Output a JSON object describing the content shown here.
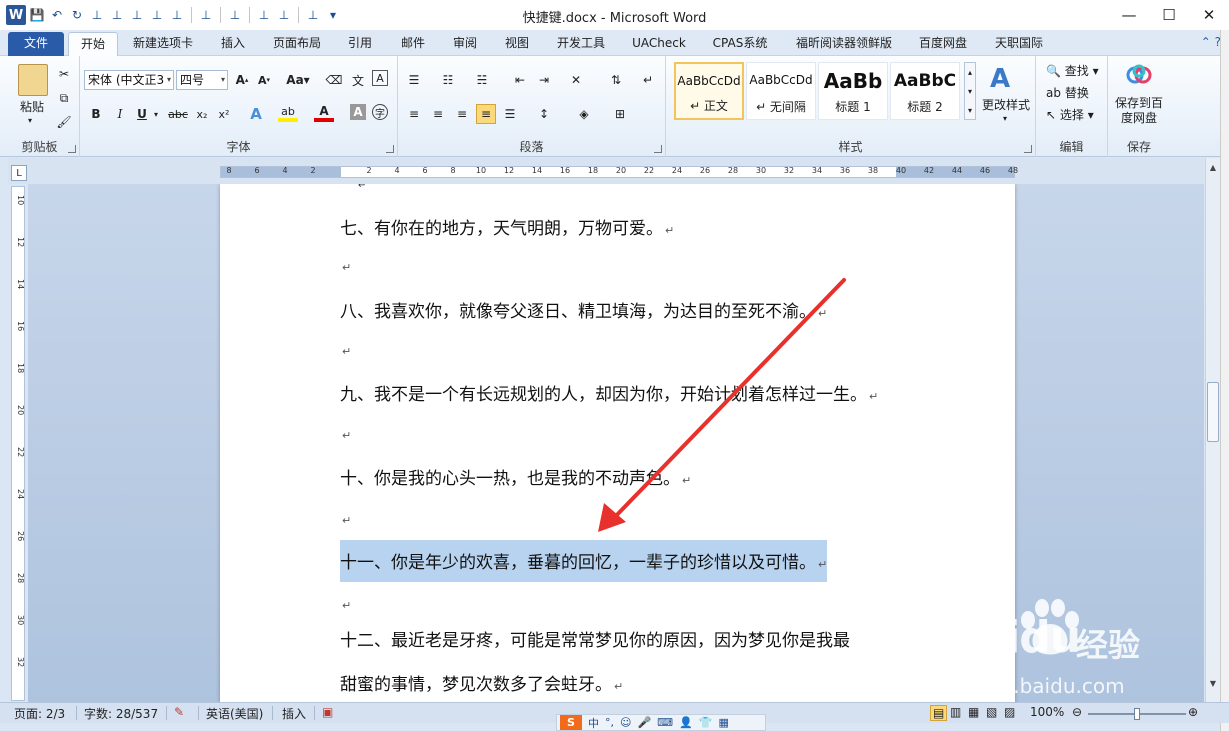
{
  "window": {
    "title": "快捷键.docx - Microsoft Word",
    "minimize": "—",
    "maximize": "☐",
    "close": "✕"
  },
  "tabs": [
    {
      "label": "文件"
    },
    {
      "label": "开始"
    },
    {
      "label": "新建选项卡"
    },
    {
      "label": "插入"
    },
    {
      "label": "页面布局"
    },
    {
      "label": "引用"
    },
    {
      "label": "邮件"
    },
    {
      "label": "审阅"
    },
    {
      "label": "视图"
    },
    {
      "label": "开发工具"
    },
    {
      "label": "UACheck"
    },
    {
      "label": "CPAS系统"
    },
    {
      "label": "福昕阅读器领鲜版"
    },
    {
      "label": "百度网盘"
    },
    {
      "label": "天职国际"
    }
  ],
  "ribbon": {
    "clipboard": {
      "paste": "粘贴",
      "group": "剪贴板"
    },
    "font": {
      "name": "宋体 (中文正3",
      "size": "四号",
      "group": "字体"
    },
    "paragraph": {
      "group": "段落"
    },
    "styles": {
      "group": "样式",
      "cards": [
        {
          "sample": "AaBbCcDd",
          "name": "↵ 正文"
        },
        {
          "sample": "AaBbCcDd",
          "name": "↵ 无间隔"
        },
        {
          "sample": "AaBb",
          "name": "标题 1"
        },
        {
          "sample": "AaBbC",
          "name": "标题 2"
        }
      ],
      "change": "更改样式"
    },
    "editing": {
      "group": "编辑",
      "find": "查找",
      "replace": "替换",
      "select": "选择"
    },
    "save": {
      "group": "保存",
      "label1": "保存到百",
      "label2": "度网盘"
    }
  },
  "ruler": {
    "h_numbers": [
      "8",
      "6",
      "4",
      "2",
      "",
      "2",
      "4",
      "6",
      "8",
      "10",
      "12",
      "14",
      "16",
      "18",
      "20",
      "22",
      "24",
      "26",
      "28",
      "30",
      "32",
      "34",
      "36",
      "38",
      "40",
      "42",
      "44",
      "46",
      "48"
    ],
    "v_numbers": [
      "10",
      "12",
      "14",
      "16",
      "18",
      "20",
      "22",
      "24",
      "26",
      "28",
      "30",
      "32"
    ]
  },
  "document": {
    "lines": [
      {
        "text": "七、有你在的地方，天气明朗，万物可爱。",
        "mark": "↵"
      },
      {
        "text": "",
        "mark": "↵"
      },
      {
        "text": "八、我喜欢你，就像夸父逐日、精卫填海，为达目的至死不渝。",
        "mark": "↵"
      },
      {
        "text": "",
        "mark": "↵"
      },
      {
        "text": "九、我不是一个有长远规划的人，却因为你，开始计划着怎样过一生。",
        "mark": "↵"
      },
      {
        "text": "",
        "mark": "↵"
      },
      {
        "text": "十、你是我的心头一热，也是我的不动声色。",
        "mark": "↵"
      },
      {
        "text": "",
        "mark": "↵"
      },
      {
        "text": "十一、你是年少的欢喜，垂暮的回忆，一辈子的珍惜以及可惜。",
        "mark": "↵"
      },
      {
        "text": "",
        "mark": "↵"
      },
      {
        "text": "十二、最近老是牙疼，可能是常常梦见你的原因，因为梦见你是我最",
        "mark": ""
      },
      {
        "text": "甜蜜的事情，梦见次数多了会蛀牙。",
        "mark": "↵"
      }
    ],
    "selected_line_index": 8
  },
  "status": {
    "page": "页面: 2/3",
    "words": "字数: 28/537",
    "language": "英语(美国)",
    "mode": "插入",
    "zoom": "100%",
    "zoom_percent": 100
  },
  "ime": {
    "logo": "S",
    "mode": "中"
  },
  "watermark": {
    "brand": "Baidu",
    "cn": "经验",
    "url": "jingyan.baidu.com"
  },
  "colors": {
    "accent": "#2a5ba9",
    "highlight": "#b8d3ef",
    "arrow": "#e8302c"
  }
}
